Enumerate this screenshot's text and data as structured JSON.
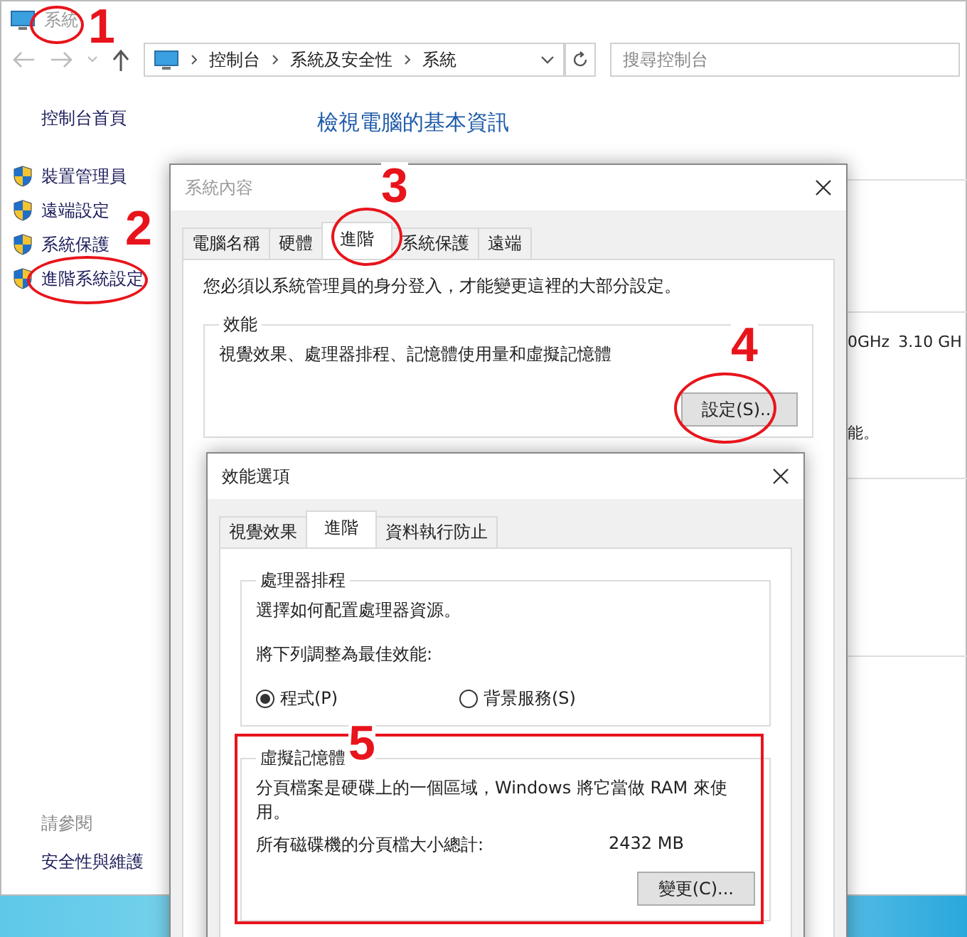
{
  "explorer": {
    "title": "系統",
    "breadcrumb": [
      "控制台",
      "系統及安全性",
      "系統"
    ],
    "search": {
      "placeholder": "搜尋控制台"
    }
  },
  "sidebar": {
    "home": "控制台首頁",
    "items": [
      {
        "label": "裝置管理員"
      },
      {
        "label": "遠端設定"
      },
      {
        "label": "系統保護"
      },
      {
        "label": "進階系統設定"
      }
    ],
    "see_also": "請參閱",
    "see_also_items": [
      "安全性與維護"
    ]
  },
  "main": {
    "heading": "檢視電腦的基本資訊",
    "fragments": [
      "0GHz",
      "3.10 GH",
      "能。"
    ]
  },
  "system_properties": {
    "title": "系統內容",
    "tabs": [
      {
        "label": "電腦名稱",
        "selected": false
      },
      {
        "label": "硬體",
        "selected": false
      },
      {
        "label": "進階",
        "selected": true
      },
      {
        "label": "系統保護",
        "selected": false
      },
      {
        "label": "遠端",
        "selected": false
      }
    ],
    "notice": "您必須以系統管理員的身分登入，才能變更這裡的大部分設定。",
    "performance": {
      "label": "效能",
      "description": "視覺效果、處理器排程、記憶體使用量和虛擬記憶體",
      "button": "設定(S)..."
    }
  },
  "performance_options": {
    "title": "效能選項",
    "tabs": [
      {
        "label": "視覺效果",
        "selected": false
      },
      {
        "label": "進階",
        "selected": true
      },
      {
        "label": "資料執行防止",
        "selected": false
      }
    ],
    "scheduling": {
      "label": "處理器排程",
      "description": "選擇如何配置處理器資源。",
      "prompt": "將下列調整為最佳效能:",
      "options": [
        {
          "label": "程式(P)",
          "selected": true
        },
        {
          "label": "背景服務(S)",
          "selected": false
        }
      ]
    },
    "virtual_memory": {
      "label": "虛擬記憶體",
      "description": "分頁檔案是硬碟上的一個區域，Windows 將它當做 RAM 來使用。",
      "total_label": "所有磁碟機的分頁檔大小總計:",
      "total_value": "2432 MB",
      "button": "變更(C)..."
    }
  },
  "annotations": {
    "markers": [
      "1",
      "2",
      "3",
      "4",
      "5"
    ]
  }
}
